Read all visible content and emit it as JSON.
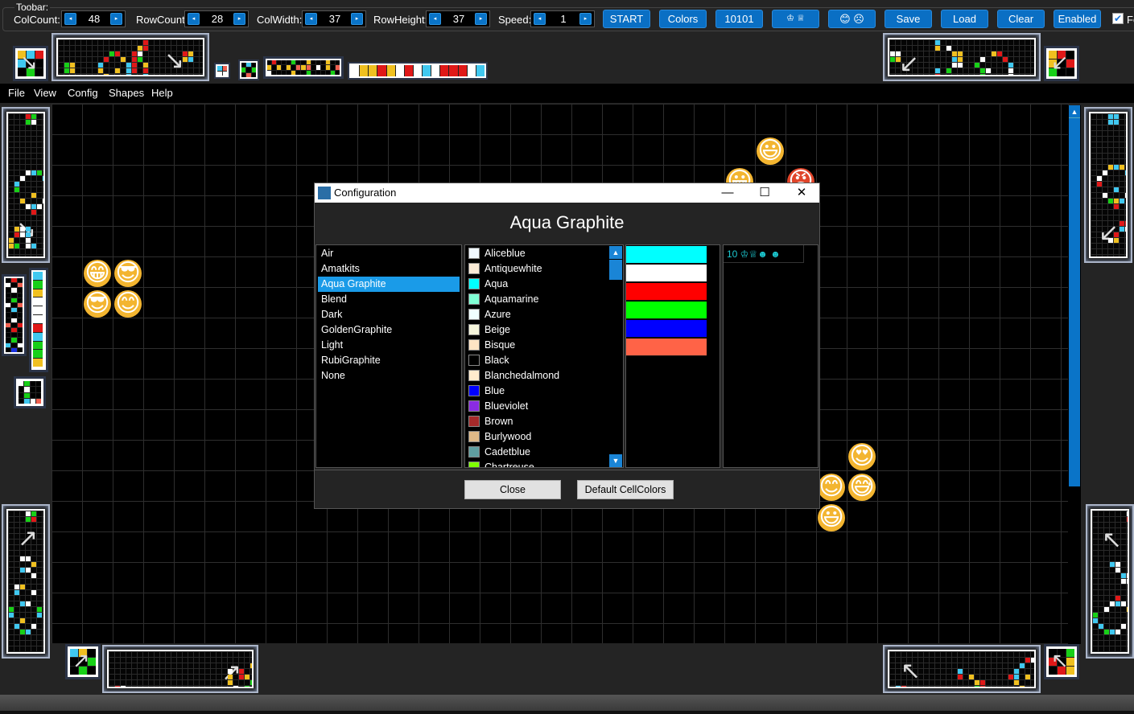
{
  "toolbar": {
    "group_label": "Toobar:",
    "col_count_label": "ColCount:",
    "col_count_value": "48",
    "row_count_label": "RowCount:",
    "row_count_value": "28",
    "col_width_label": "ColWidth:",
    "col_width_value": "37",
    "row_height_label": "RowHeight:",
    "row_height_value": "37",
    "speed_label": "Speed:",
    "speed_value": "1",
    "decrement_glyph": "◂",
    "increment_glyph": "▸",
    "start_label": "START",
    "colors_label": "Colors",
    "binary_label": "10101",
    "chess_label": "♔ ♕",
    "smileys_label": "😊 ☹",
    "save_label": "Save",
    "load_label": "Load",
    "clear_label": "Clear",
    "enabled_label": "Enabled",
    "checkbox_checked": true,
    "checkbox_mark": "✔",
    "checkbox_label": "Fe"
  },
  "menu": {
    "items": [
      "File",
      "View",
      "Config",
      "Shapes",
      "Help"
    ]
  },
  "colors": {
    "accent": "#0a6fc4",
    "selection": "#1a9be8",
    "background": "#242424",
    "grid": "#000000"
  },
  "canvas_emojis": [
    {
      "glyph": "😃",
      "name": "grinning-face-big-eyes"
    },
    {
      "glyph": "😀",
      "name": "grinning-face-partial"
    },
    {
      "glyph": "😡",
      "name": "angry-face-partial"
    },
    {
      "glyph": "😁",
      "name": "beaming-face"
    },
    {
      "glyph": "😎",
      "name": "sunglasses-face"
    },
    {
      "glyph": "😎",
      "name": "sunglasses-face"
    },
    {
      "glyph": "😊",
      "name": "smiling-face-blush"
    },
    {
      "glyph": "😍",
      "name": "heart-eyes-face"
    },
    {
      "glyph": "😊",
      "name": "smiling-face-blush"
    },
    {
      "glyph": "😅",
      "name": "grinning-sweat-face"
    },
    {
      "glyph": "😃",
      "name": "grinning-face-big-eyes"
    }
  ],
  "dialog": {
    "title": "Configuration",
    "minimize_glyph": "—",
    "maximize_glyph": "☐",
    "close_glyph": "✕",
    "heading": "Aqua Graphite",
    "themes": [
      "Air",
      "Amatkits",
      "Aqua Graphite",
      "Blend",
      "Dark",
      "GoldenGraphite",
      "Light",
      "RubiGraphite",
      "None"
    ],
    "selected_theme": "Aqua Graphite",
    "named_colors": [
      {
        "name": "Aliceblue",
        "hex": "#f0f8ff"
      },
      {
        "name": "Antiquewhite",
        "hex": "#faebd7"
      },
      {
        "name": "Aqua",
        "hex": "#00ffff"
      },
      {
        "name": "Aquamarine",
        "hex": "#7fffd4"
      },
      {
        "name": "Azure",
        "hex": "#f0ffff"
      },
      {
        "name": "Beige",
        "hex": "#f5f5dc"
      },
      {
        "name": "Bisque",
        "hex": "#ffe4c4"
      },
      {
        "name": "Black",
        "hex": "#000000"
      },
      {
        "name": "Blanchedalmond",
        "hex": "#ffebcd"
      },
      {
        "name": "Blue",
        "hex": "#0000ff"
      },
      {
        "name": "Blueviolet",
        "hex": "#8a2be2"
      },
      {
        "name": "Brown",
        "hex": "#a52a2a"
      },
      {
        "name": "Burlywood",
        "hex": "#deb887"
      },
      {
        "name": "Cadetblue",
        "hex": "#5f9ea0"
      },
      {
        "name": "Chartreuse",
        "hex": "#7fff00"
      }
    ],
    "scroll_up_glyph": "▲",
    "scroll_down_glyph": "▼",
    "cell_colors": [
      "#00ffff",
      "#ffffff",
      "#ff0000",
      "#00ff00",
      "#0000ff",
      "#ff6347"
    ],
    "cell_symbols": "10 ♔♕☻ ☻",
    "close_label": "Close",
    "default_colors_label": "Default CellColors"
  },
  "vscroll_up_glyph": "▲",
  "pattern_arrow_glyphs": {
    "down_right": "↘",
    "down_left": "↙",
    "up_left": "↖",
    "up_right": "↗"
  }
}
